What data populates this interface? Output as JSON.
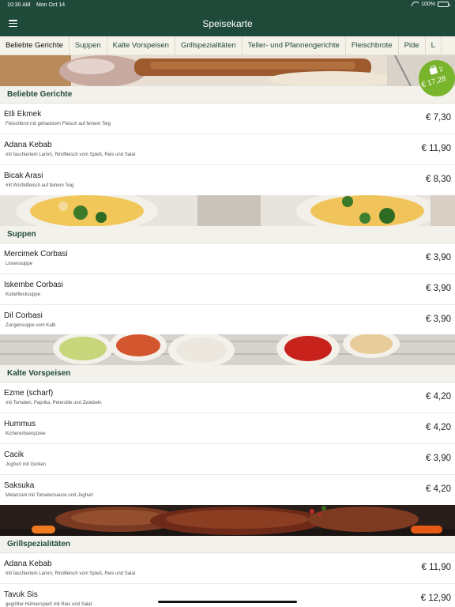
{
  "status_bar": {
    "time": "10:30 AM",
    "date": "Mon Oct 14",
    "battery": "100%"
  },
  "header": {
    "title": "Speisekarte"
  },
  "tabs": [
    {
      "label": "Beliebte Gerichte"
    },
    {
      "label": "Suppen"
    },
    {
      "label": "Kalte Vorspeisen"
    },
    {
      "label": "Grillspezialitäten"
    },
    {
      "label": "Teller- und Pfannengerichte"
    },
    {
      "label": "Fleischbrote"
    },
    {
      "label": "Pide"
    },
    {
      "label": "L"
    }
  ],
  "cart": {
    "count": "2",
    "total": "€ 17,28"
  },
  "sections": [
    {
      "title": "Beliebte Gerichte",
      "items": [
        {
          "name": "Etli Ekmek",
          "desc": "Fleischbrot mit gehacktem Fleisch auf feinem Teig",
          "price": "€ 7,30"
        },
        {
          "name": "Adana Kebab",
          "desc": "mit faschiertem Lamm, Rindfleisch vom Spieß, Reis und Salat",
          "price": "€ 11,90"
        },
        {
          "name": "Bicak Arasi",
          "desc": "mit Würfelfleisch auf feinem Teig",
          "price": "€ 8,30"
        }
      ]
    },
    {
      "title": "Suppen",
      "items": [
        {
          "name": "Mercimek Corbasi",
          "desc": "Linsensuppe",
          "price": "€ 3,90"
        },
        {
          "name": "Iskembe Corbasi",
          "desc": "Kuttelflecksuppe",
          "price": "€ 3,90"
        },
        {
          "name": "Dil Corbasi",
          "desc": "Zungensuppe vom Kalb",
          "price": "€ 3,90"
        }
      ]
    },
    {
      "title": "Kalte Vorspeisen",
      "items": [
        {
          "name": "Ezme (scharf)",
          "desc": "mit Tomaten, Paprika, Petersilie und Zwiebeln",
          "price": "€ 4,20"
        },
        {
          "name": "Hummus",
          "desc": "Kichererbsenpüree",
          "price": "€ 4,20"
        },
        {
          "name": "Cacik",
          "desc": "Joghurt mit Gurken",
          "price": "€ 3,90"
        },
        {
          "name": "Saksuka",
          "desc": "Melanzani mit Tomatensauce und Joghurt",
          "price": "€ 4,20"
        }
      ]
    },
    {
      "title": "Grillspezialitäten",
      "items": [
        {
          "name": "Adana Kebab",
          "desc": "mit faschiertem Lamm, Rindfleisch vom Spieß, Reis und Salat",
          "price": "€ 11,90"
        },
        {
          "name": "Tavuk Sis",
          "desc": "gegrillter Hühnerspieß mit Reis und Salat",
          "price": "€ 12,90"
        }
      ]
    }
  ]
}
